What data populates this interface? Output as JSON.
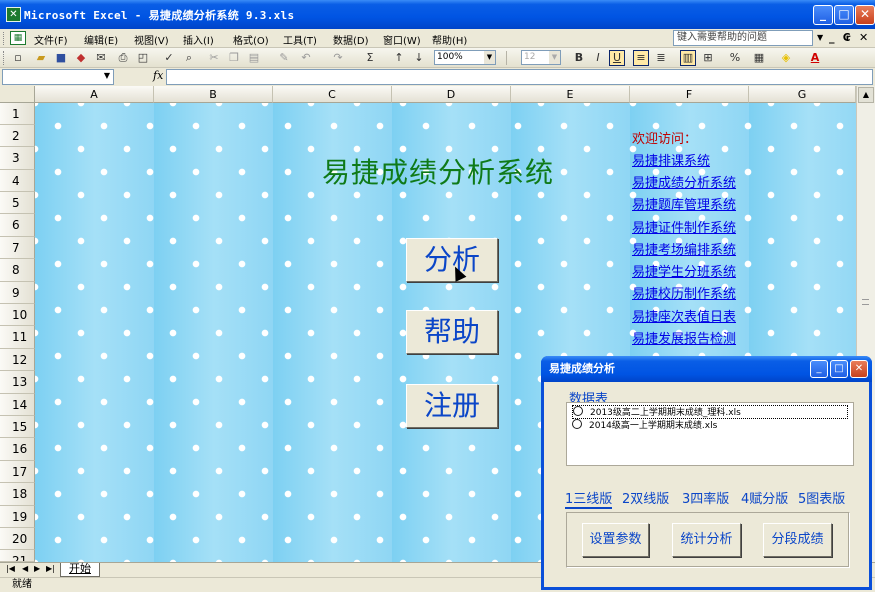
{
  "window": {
    "title": "Microsoft Excel - 易捷成绩分析系统 9.3.xls",
    "minimize": "_",
    "maximize": "□",
    "close": "✕"
  },
  "menu": {
    "items": [
      "文件(F)",
      "编辑(E)",
      "视图(V)",
      "插入(I)",
      "格式(O)",
      "工具(T)",
      "数据(D)",
      "窗口(W)",
      "帮助(H)"
    ],
    "help_placeholder": "键入需要帮助的问题",
    "mdi_min": "_",
    "mdi_restore": "₢",
    "mdi_close": "✕"
  },
  "toolbar": {
    "zoom": "100%",
    "font_size": "12",
    "bold": "B",
    "italic": "I",
    "underline": "U"
  },
  "formula_bar": {
    "name_box": "",
    "fx": "fx",
    "formula": ""
  },
  "columns": [
    "A",
    "B",
    "C",
    "D",
    "E",
    "F",
    "G"
  ],
  "rows": [
    "1",
    "2",
    "3",
    "4",
    "5",
    "6",
    "7",
    "8",
    "9",
    "10",
    "11",
    "12",
    "13",
    "14",
    "15",
    "16",
    "17",
    "18",
    "19",
    "20",
    "21"
  ],
  "sheet": {
    "system_title": "易捷成绩分析系统",
    "btn_analyze": "分析",
    "btn_help": "帮助",
    "btn_register": "注册",
    "welcome": "欢迎访问：",
    "links": [
      "易捷排课系统",
      "易捷成绩分析系统",
      "易捷题库管理系统",
      "易捷证件制作系统",
      "易捷考场编排系统",
      "易捷学生分班系统",
      "易捷校历制作系统",
      "易捷座次表值日表",
      "易捷发展报告检测"
    ]
  },
  "tabs": {
    "sheet_tab": "开始"
  },
  "status": {
    "text": "就绪"
  },
  "dialog": {
    "title": "易捷成绩分析",
    "group_label": "数据表",
    "files": [
      "2013级高二上学期期末成绩_理科.xls",
      "2014级高一上学期期末成绩.xls"
    ],
    "tabs": [
      "1三线版",
      "2双线版",
      "3四率版",
      "4赋分版",
      "5图表版"
    ],
    "buttons": [
      "设置参数",
      "统计分析",
      "分段成绩"
    ]
  }
}
